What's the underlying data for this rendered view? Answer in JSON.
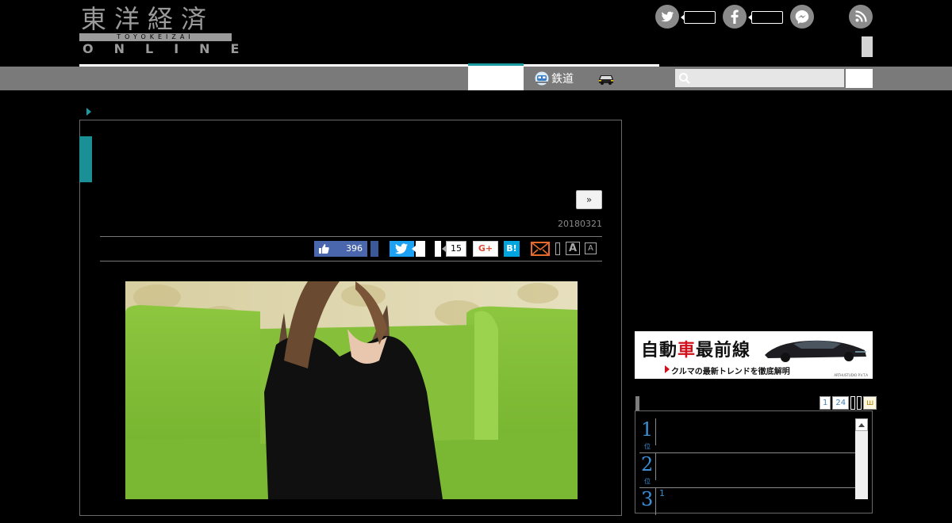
{
  "header": {
    "logo_kanji": "東洋経済",
    "logo_roman": "TOYOKEIZAI",
    "logo_online": "ONLINE",
    "nav": {
      "rail_label": "鉄道"
    },
    "search": {
      "placeholder": ""
    }
  },
  "article": {
    "next_label": "»",
    "date": "20180321",
    "share": {
      "like_count": "396",
      "pocket_count": "15",
      "gplus_label": "G+",
      "hatena_label": "B!",
      "font_large": "A",
      "font_small": "A"
    }
  },
  "sidebar": {
    "banner": {
      "title_part1": "自動",
      "title_red": "車",
      "title_part2": "最前線",
      "subtitle": "クルマの最新トレンドを徹底解明",
      "credit": "ARTHUSTUDIO P.V.T.A"
    },
    "ranking": {
      "tabs": [
        "1",
        "24",
        "",
        "",
        "ш"
      ],
      "items": [
        {
          "rank": "1",
          "unit": "位",
          "sub": ""
        },
        {
          "rank": "2",
          "unit": "位",
          "sub": ""
        },
        {
          "rank": "3",
          "unit": "",
          "sub": "1"
        }
      ]
    }
  },
  "colors": {
    "accent": "#1b9aa0",
    "nav": "#7a7a7a",
    "like": "#4a66ad",
    "twitter": "#1da1f2",
    "hatena": "#00a4de",
    "banner_red": "#d0101a"
  }
}
